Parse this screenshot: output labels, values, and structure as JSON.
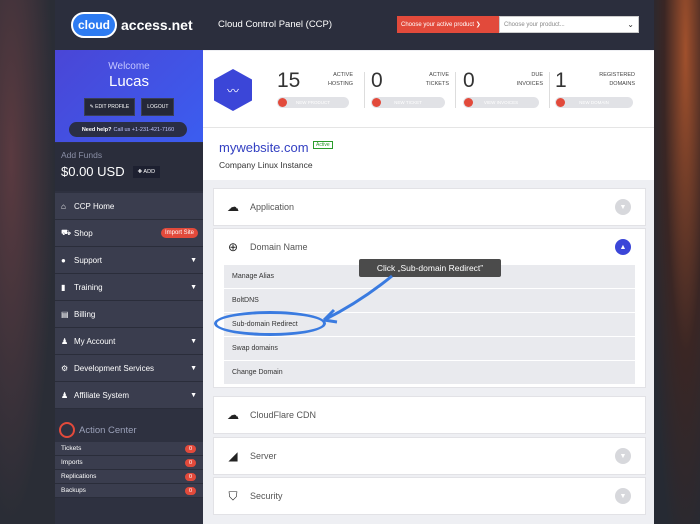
{
  "brand": {
    "logo_text": "cloud",
    "name": "access.net"
  },
  "topbar": {
    "title": "Cloud Control Panel (CCP)",
    "choose_label": "Choose your active product ❯",
    "select_placeholder": "Choose your product..."
  },
  "profile": {
    "welcome": "Welcome",
    "user": "Lucas",
    "edit_label": "✎ EDIT PROFILE",
    "logout_label": "LOGOUT",
    "help_label": "Need help?",
    "help_text": "Call us +1-231-421-7160"
  },
  "funds": {
    "label": "Add Funds",
    "amount": "$0.00 USD",
    "add_label": "✚ ADD"
  },
  "sidebar": {
    "items": [
      {
        "label": "CCP Home",
        "icon": "home-icon"
      },
      {
        "label": "Shop",
        "icon": "cart-icon",
        "badge": "Import Site"
      },
      {
        "label": "Support",
        "icon": "chat-icon"
      },
      {
        "label": "Training",
        "icon": "book-icon"
      },
      {
        "label": "Billing",
        "icon": "billing-icon"
      },
      {
        "label": "My Account",
        "icon": "user-icon"
      },
      {
        "label": "Development Services",
        "icon": "gears-icon"
      },
      {
        "label": "Affiliate System",
        "icon": "users-icon"
      }
    ]
  },
  "action_center": {
    "title": "Action Center",
    "rows": [
      {
        "label": "Tickets",
        "count": "0"
      },
      {
        "label": "Imports",
        "count": "0"
      },
      {
        "label": "Replications",
        "count": "0"
      },
      {
        "label": "Backups",
        "count": "0"
      }
    ]
  },
  "stats": [
    {
      "num": "15",
      "label1": "ACTIVE",
      "label2": "HOSTING",
      "button": "NEW PRODUCT"
    },
    {
      "num": "0",
      "label1": "ACTIVE",
      "label2": "TICKETS",
      "button": "NEW TICKET"
    },
    {
      "num": "0",
      "label1": "DUE",
      "label2": "INVOICES",
      "button": "VIEW INVOICES"
    },
    {
      "num": "1",
      "label1": "REGISTERED",
      "label2": "DOMAINS",
      "button": "NEW DOMAIN"
    }
  ],
  "site": {
    "domain": "mywebsite.com",
    "status": "Active",
    "description": "Company Linux Instance"
  },
  "accordion": [
    {
      "title": "Application",
      "icon": "cloud-icon"
    },
    {
      "title": "Domain Name",
      "icon": "globe-icon"
    },
    {
      "title": "CloudFlare CDN",
      "icon": "cloudflare-icon"
    },
    {
      "title": "Server",
      "icon": "chart-icon"
    },
    {
      "title": "Security",
      "icon": "shield-icon"
    }
  ],
  "domain_items": [
    "Manage Alias",
    "BoltDNS",
    "Sub-domain Redirect",
    "Swap domains",
    "Change Domain"
  ],
  "annotation": {
    "tooltip": "Click „Sub-domain Redirect”"
  },
  "colors": {
    "accent": "#3b46d8",
    "danger": "#e24a3b",
    "highlight": "#3a7be0",
    "sidebar": "#2e3140"
  }
}
